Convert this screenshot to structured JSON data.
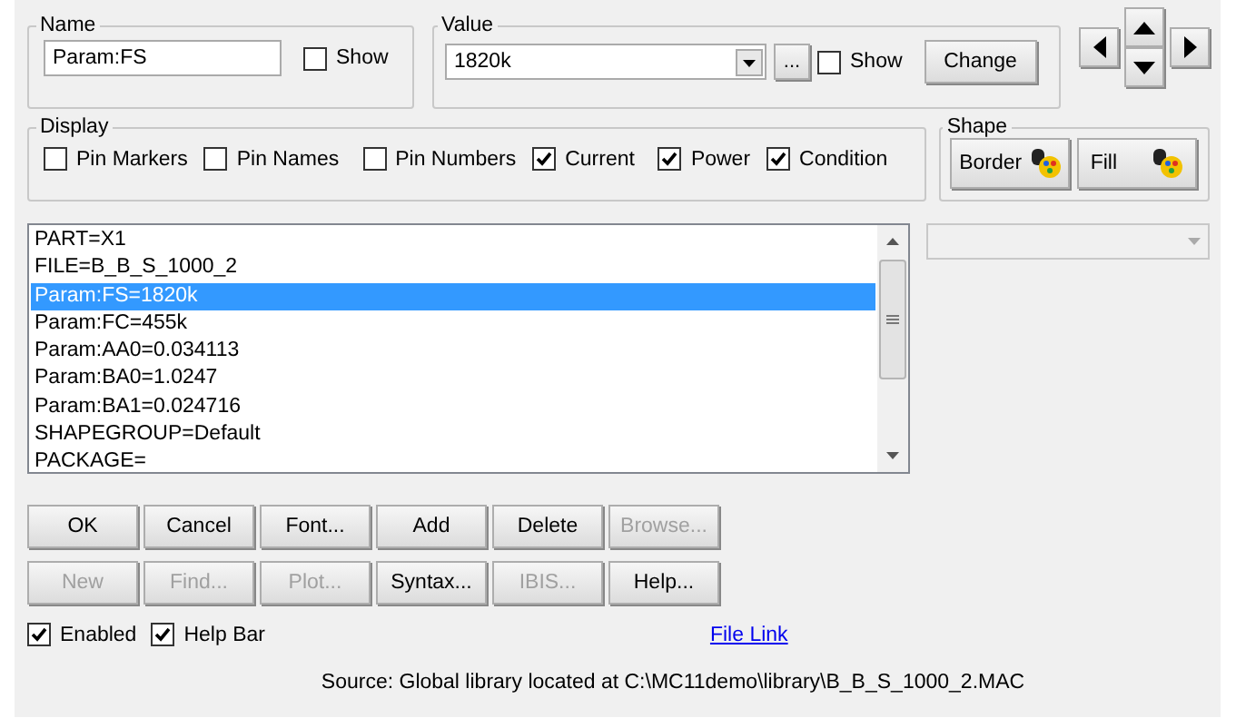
{
  "name_group": {
    "label": "Name",
    "value": "Param:FS",
    "show": {
      "label": "Show",
      "checked": false
    }
  },
  "value_group": {
    "label": "Value",
    "value": "1820k",
    "browse": "...",
    "show": {
      "label": "Show",
      "checked": false
    },
    "change": "Change"
  },
  "display": {
    "label": "Display",
    "options": [
      {
        "label": "Pin Markers",
        "checked": false
      },
      {
        "label": "Pin Names",
        "checked": false
      },
      {
        "label": "Pin Numbers",
        "checked": false
      },
      {
        "label": "Current",
        "checked": true
      },
      {
        "label": "Power",
        "checked": true
      },
      {
        "label": "Condition",
        "checked": true
      }
    ]
  },
  "shape": {
    "label": "Shape",
    "buttons": [
      "Border",
      "Fill"
    ]
  },
  "attributes": [
    {
      "text": "PART=X1",
      "selected": false
    },
    {
      "text": "FILE=B_B_S_1000_2",
      "selected": false
    },
    {
      "text": "Param:FS=1820k",
      "selected": true
    },
    {
      "text": "Param:FC=455k",
      "selected": false
    },
    {
      "text": "Param:AA0=0.034113",
      "selected": false
    },
    {
      "text": "Param:BA0=1.0247",
      "selected": false
    },
    {
      "text": "Param:BA1=0.024716",
      "selected": false
    },
    {
      "text": "SHAPEGROUP=Default",
      "selected": false
    },
    {
      "text": "PACKAGE=",
      "selected": false
    }
  ],
  "buttons": [
    {
      "label": "OK",
      "disabled": false
    },
    {
      "label": "Cancel",
      "disabled": false
    },
    {
      "label": "Font...",
      "disabled": false
    },
    {
      "label": "Add",
      "disabled": false
    },
    {
      "label": "Delete",
      "disabled": false
    },
    {
      "label": "Browse...",
      "disabled": true
    },
    {
      "label": "New",
      "disabled": true
    },
    {
      "label": "Find...",
      "disabled": true
    },
    {
      "label": "Plot...",
      "disabled": true
    },
    {
      "label": "Syntax...",
      "disabled": false
    },
    {
      "label": "IBIS...",
      "disabled": true
    },
    {
      "label": "Help...",
      "disabled": false
    }
  ],
  "options": [
    {
      "label": "Enabled",
      "checked": true
    },
    {
      "label": "Help Bar",
      "checked": true
    }
  ],
  "link": "File Link",
  "status": "Source: Global library located at C:\\MC11demo\\library\\B_B_S_1000_2.MAC"
}
